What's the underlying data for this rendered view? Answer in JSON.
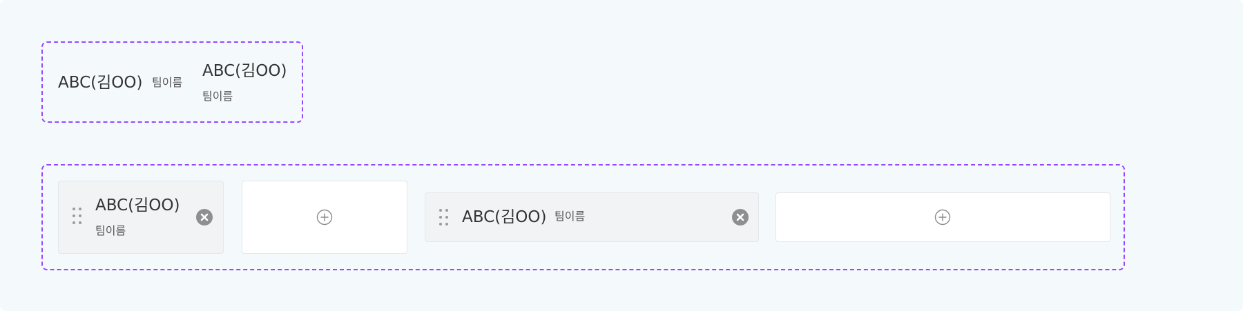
{
  "top_group": {
    "inline_item": {
      "name": "ABC(김OO)",
      "team": "팀이름"
    },
    "stacked_item": {
      "name": "ABC(김OO)",
      "team": "팀이름"
    }
  },
  "bottom_group": {
    "stacked_card": {
      "name": "ABC(김OO)",
      "team": "팀이름"
    },
    "inline_card": {
      "name": "ABC(김OO)",
      "team": "팀이름"
    }
  },
  "icons": {
    "drag": "drag-handle-icon",
    "remove": "close-circle-icon",
    "add": "plus-circle-icon"
  },
  "colors": {
    "group_border": "#9747ff",
    "card_background": "#f2f3f5",
    "remove_button": "#8f8f8f",
    "page_background": "#f4f9fc"
  }
}
